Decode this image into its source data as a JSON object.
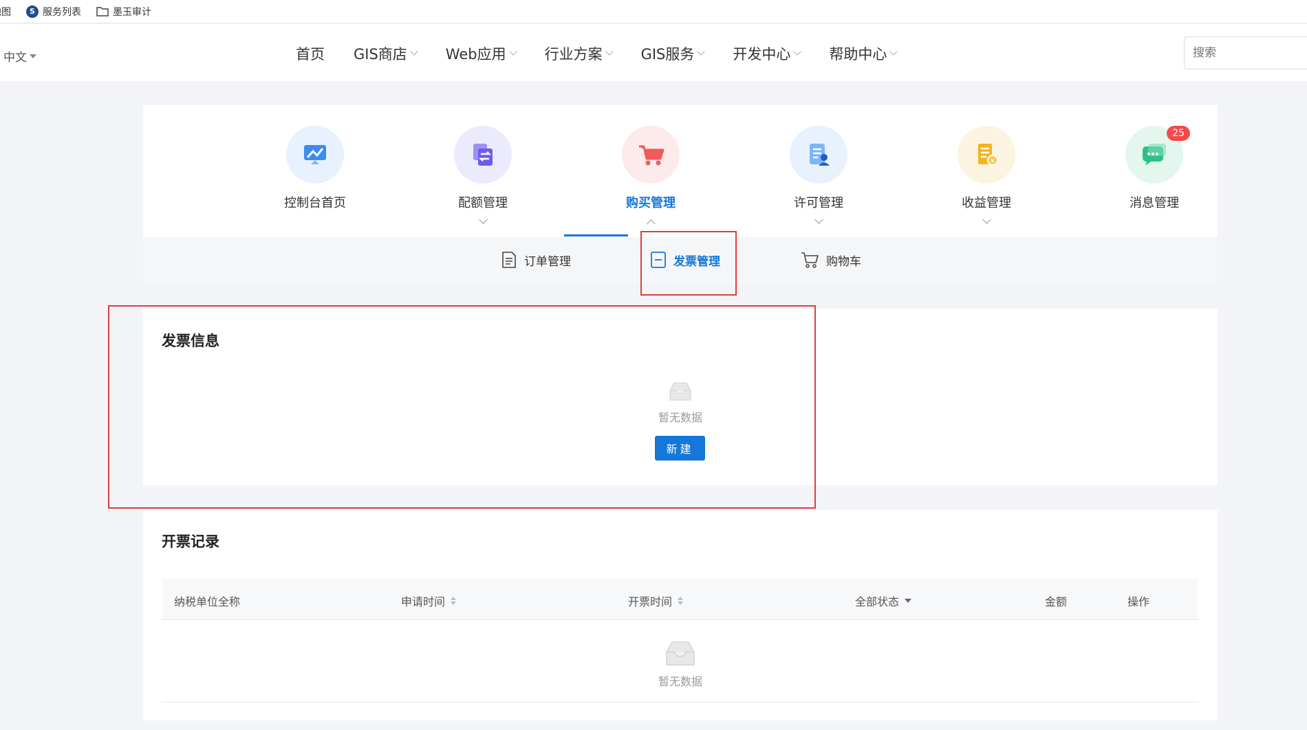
{
  "bookmarks": [
    {
      "label": "地图",
      "icon": "globe-icon"
    },
    {
      "label": "服务列表",
      "icon": "logo-icon"
    },
    {
      "label": "墨玉审计",
      "icon": "folder-icon"
    }
  ],
  "header": {
    "language": "中文",
    "nav": [
      "首页",
      "GIS商店",
      "Web应用",
      "行业方案",
      "GIS服务",
      "开发中心",
      "帮助中心"
    ],
    "search_placeholder": "搜索"
  },
  "modules": [
    {
      "label": "控制台首页",
      "icon": "dashboard-icon",
      "color": "#3b8cf0"
    },
    {
      "label": "配额管理",
      "icon": "quota-icon",
      "color": "#6b5cf0"
    },
    {
      "label": "购买管理",
      "icon": "cart-icon",
      "color": "#f05a5a",
      "active": true
    },
    {
      "label": "许可管理",
      "icon": "license-icon",
      "color": "#3b8cf0"
    },
    {
      "label": "收益管理",
      "icon": "revenue-icon",
      "color": "#f5b320"
    },
    {
      "label": "消息管理",
      "icon": "message-icon",
      "color": "#2fc08a",
      "badge": "25"
    }
  ],
  "subtabs": [
    {
      "label": "订单管理",
      "icon": "order-icon"
    },
    {
      "label": "发票管理",
      "icon": "invoice-icon",
      "active": true
    },
    {
      "label": "购物车",
      "icon": "cart-outline-icon"
    }
  ],
  "invoice_info": {
    "title": "发票信息",
    "empty_text": "暂无数据",
    "new_button": "新建"
  },
  "records": {
    "title": "开票记录",
    "columns": [
      "纳税单位全称",
      "申请时间",
      "开票时间",
      "全部状态",
      "金额",
      "操作"
    ],
    "empty_text": "暂无数据"
  },
  "colors": {
    "accent": "#1477d9",
    "highlight": "#e03c3c",
    "badge": "#f24b4b"
  }
}
